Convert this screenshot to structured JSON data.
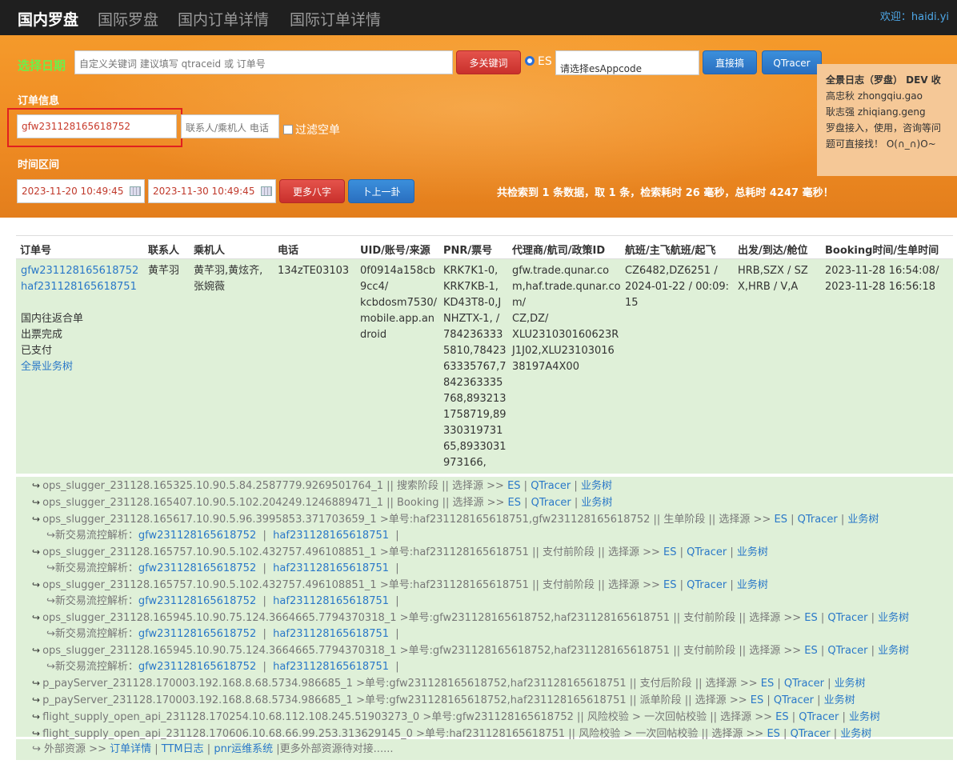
{
  "nav": {
    "tabs": [
      "国内罗盘",
      "国际罗盘",
      "国内订单详情",
      "国际订单详情"
    ],
    "welcome": "欢迎：haidi.yi"
  },
  "search": {
    "date_label": "选择日期",
    "keyword_placeholder": "自定义关键词 建议填写 qtraceid 或 订单号",
    "multi_keyword_btn": "多关键词",
    "es_label": "ES",
    "appcode_placeholder": "请选择esAppcode",
    "direct_btn": "直接搞",
    "qtracer_btn": "QTracer",
    "order_info_label": "订单信息",
    "order_value": "gfw231128165618752",
    "contact_placeholder": "联系人/乘机人 电话",
    "filter_empty_label": "过滤空单",
    "time_range_label": "时间区间",
    "start_time": "2023-11-20 10:49:45",
    "end_time": "2023-11-30 10:49:45",
    "more_bazi_btn": "更多八字",
    "divine_btn": "卜上一卦",
    "stat_text": "共检索到 1 条数据，取 1 条，检索耗时 26 毫秒，总耗时 4247 毫秒！"
  },
  "side_panel": {
    "title": "全景日志（罗盘） DEV  收",
    "lines": [
      "高忠秋 zhongqiu.gao",
      "耿志强 zhiqiang.geng",
      "罗盘接入，使用，咨询等问",
      "题可直接找！ O(∩_∩)O~"
    ]
  },
  "table": {
    "headers": [
      "订单号",
      "联系人",
      "乘机人",
      "电话",
      "UID/账号/来源",
      "PNR/票号",
      "代理商/航司/政策ID",
      "航班/主飞航班/起飞",
      "出发/到达/舱位",
      "Booking时间/生单时间"
    ],
    "row": {
      "order_no_1": "gfw231128165618752",
      "order_no_2": "haf231128165618751",
      "order_type": "国内往返合单",
      "ticket_status": "出票完成",
      "pay_status": "已支付",
      "biz_tree_link": "全景业务树",
      "contact": "黄芊羽",
      "passengers_1": "黄芊羽,黄炫齐,",
      "passengers_2": "张婉薇",
      "phone": "134zTE03103",
      "uid_lines": [
        "0f0914a158cb",
        "9cc4/",
        "kcbdosm7530/",
        "mobile.app.an",
        "droid"
      ],
      "pnr_lines": [
        "KRK7K1-0,",
        "KRK7KB-1,",
        "KD43T8-0,J",
        "NHZTX-1, /",
        "784236333",
        "5810,78423",
        "63335767,7",
        "842363335",
        "768,893213",
        "1758719,89",
        "330319731",
        "65,8933031",
        "973166,"
      ],
      "agent_lines": [
        "gfw.trade.qunar.co",
        "m,haf.trade.qunar.co",
        "m/",
        "CZ,DZ/",
        "XLU231030160623R",
        "J1J02,XLU23103016",
        "38197A4X00"
      ],
      "flight_lines": [
        "CZ6482,DZ6251 /",
        "2024-01-22 / 00:09:",
        "15"
      ],
      "route_lines": [
        "HRB,SZX / SZ",
        "X,HRB / V,A"
      ],
      "booking_lines": [
        "2023-11-28 16:54:08/",
        "2023-11-28 16:56:18"
      ]
    }
  },
  "logs": [
    {
      "text": "ops_slugger_231128.165325.10.90.5.84.2587779.9269501764_1 || 搜索阶段 || 选择源 >> ",
      "sub": null
    },
    {
      "text": "ops_slugger_231128.165407.10.90.5.102.204249.1246889471_1 || Booking  || 选择源 >> ",
      "sub": null
    },
    {
      "text": "ops_slugger_231128.165617.10.90.5.96.3995853.371703659_1 >单号:haf231128165618751,gfw231128165618752 || 生单阶段 || 选择源 >> ",
      "sub": [
        "gfw231128165618752",
        "haf231128165618751"
      ]
    },
    {
      "text": "ops_slugger_231128.165757.10.90.5.102.432757.496108851_1 >单号:haf231128165618751 || 支付前阶段 || 选择源 >> ",
      "sub": [
        "gfw231128165618752",
        "haf231128165618751"
      ]
    },
    {
      "text": "ops_slugger_231128.165757.10.90.5.102.432757.496108851_1 >单号:haf231128165618751 || 支付前阶段 || 选择源 >> ",
      "sub": [
        "gfw231128165618752",
        "haf231128165618751"
      ]
    },
    {
      "text": "ops_slugger_231128.165945.10.90.75.124.3664665.7794370318_1 >单号:gfw231128165618752,haf231128165618751 || 支付前阶段 || 选择源 >> ",
      "sub": [
        "gfw231128165618752",
        "haf231128165618751"
      ]
    },
    {
      "text": "ops_slugger_231128.165945.10.90.75.124.3664665.7794370318_1 >单号:gfw231128165618752,haf231128165618751 || 支付前阶段 || 选择源 >> ",
      "sub": [
        "gfw231128165618752",
        "haf231128165618751"
      ]
    },
    {
      "text": "p_payServer_231128.170003.192.168.8.68.5734.986685_1 >单号:gfw231128165618752,haf231128165618751 || 支付后阶段 || 选择源 >> ",
      "sub": null
    },
    {
      "text": "p_payServer_231128.170003.192.168.8.68.5734.986685_1 >单号:gfw231128165618752,haf231128165618751 || 派单阶段 || 选择源 >> ",
      "sub": null
    },
    {
      "text": "flight_supply_open_api_231128.170254.10.68.112.108.245.51903273_0 >单号:gfw231128165618752 || 风险校验 > 一次回帖校验 || 选择源 >> ",
      "sub": null
    },
    {
      "text": "flight_supply_open_api_231128.170606.10.68.66.99.253.313629145_0 >单号:haf231128165618751 || 风险校验 > 一次回帖校验 || 选择源 >> ",
      "sub": null
    }
  ],
  "log_links": {
    "es": "ES",
    "qtracer": "QTracer",
    "biz_tree": "业务树",
    "sub_label": "新交易流控解析："
  },
  "external": {
    "prefix": "外部资源 >> ",
    "order_detail": "订单详情",
    "ttm": "TTM日志",
    "pnr": "pnr运维系统",
    "suffix": "|更多外部资源待对接......"
  }
}
